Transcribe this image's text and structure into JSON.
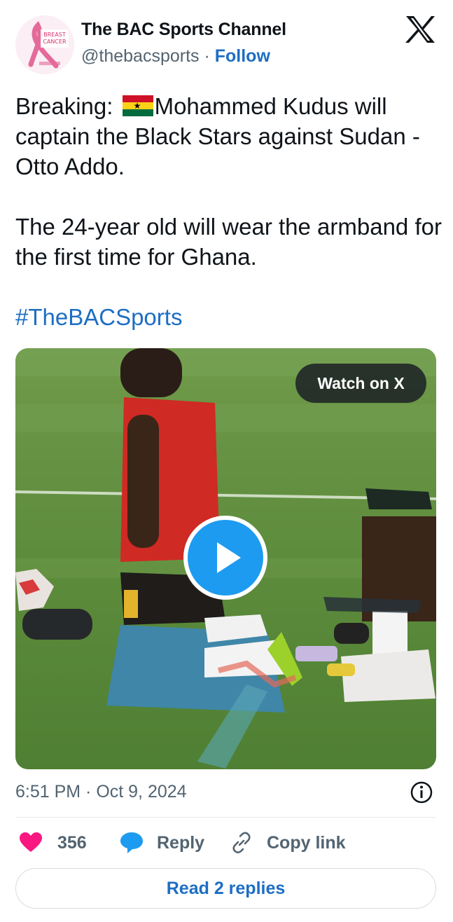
{
  "author": {
    "name": "The BAC Sports Channel",
    "handle": "@thebacsports",
    "separator": " · ",
    "follow_label": "Follow",
    "avatar_text_line1": "BREAST",
    "avatar_text_line2": "CANCER"
  },
  "tweet": {
    "line1_prefix": "Breaking: ",
    "line1_suffix": "Mohammed Kudus will captain the Black Stars against Sudan - Otto Addo.",
    "paragraph2": "The 24-year old will wear the armband for the first time for Ghana.",
    "hashtag": "#TheBACSports"
  },
  "media": {
    "watch_label": "Watch on X"
  },
  "meta": {
    "timestamp": "6:51 PM · Oct 9, 2024"
  },
  "actions": {
    "like_count": "356",
    "reply_label": "Reply",
    "copy_label": "Copy link"
  },
  "footer": {
    "read_replies_label": "Read 2 replies"
  },
  "colors": {
    "link": "#1d6ec4",
    "like": "#f91880",
    "reply": "#1d9bf0",
    "text": "#0f1419",
    "muted": "#536471"
  }
}
